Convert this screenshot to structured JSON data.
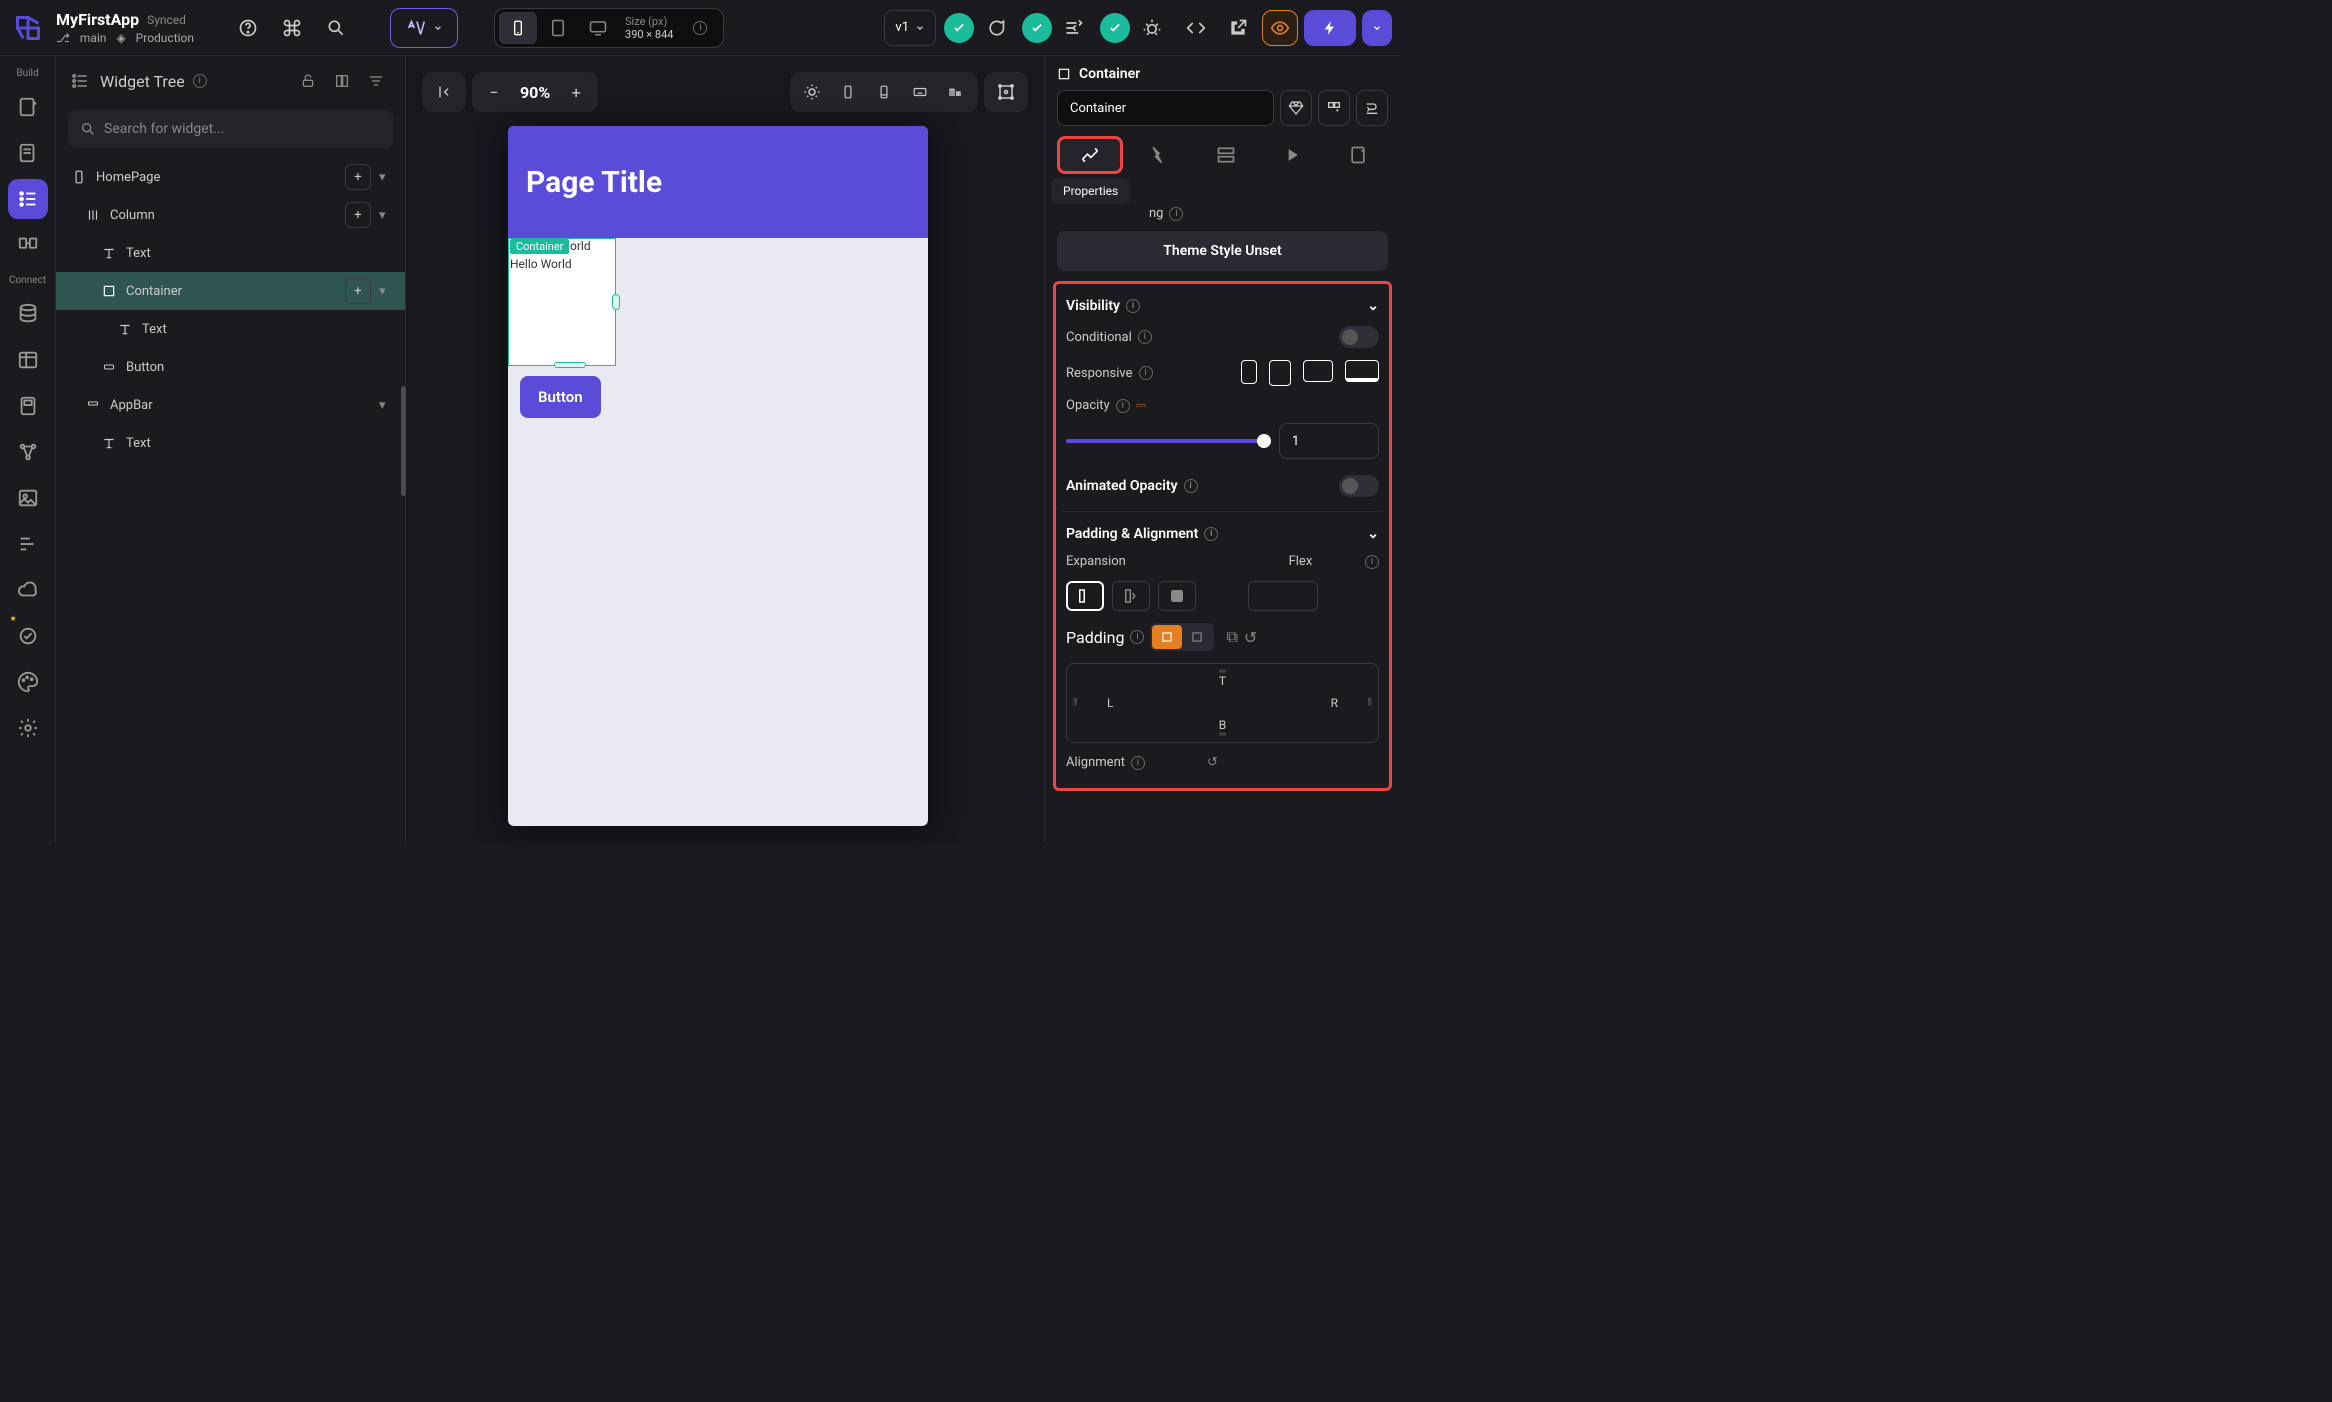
{
  "app": {
    "name": "MyFirstApp",
    "sync": "Synced",
    "branch": "main",
    "env": "Production"
  },
  "device": {
    "sizeLabel": "Size (px)",
    "sizeValue": "390 × 844"
  },
  "version": "v1",
  "zoom": "90%",
  "leftRail": {
    "build": "Build",
    "connect": "Connect"
  },
  "tree": {
    "title": "Widget Tree",
    "searchPlaceholder": "Search for widget...",
    "items": {
      "homepage": "HomePage",
      "column": "Column",
      "text1": "Text",
      "container": "Container",
      "text2": "Text",
      "button": "Button",
      "appbar": "AppBar",
      "text3": "Text"
    }
  },
  "canvas": {
    "pageTitle": "Page Title",
    "selectedLabel": "Container",
    "hello1": "orld",
    "hello2": "Hello World",
    "buttonLabel": "Button"
  },
  "props": {
    "crumb": "Container",
    "nameValue": "Container",
    "tooltip": "Properties",
    "stylingLabel": "ng",
    "themeStyle": "Theme Style Unset",
    "visibility": "Visibility",
    "conditional": "Conditional",
    "responsive": "Responsive",
    "opacity": "Opacity",
    "opacityValue": "1",
    "animatedOpacity": "Animated Opacity",
    "paddingAlign": "Padding & Alignment",
    "expansion": "Expansion",
    "flex": "Flex",
    "padding": "Padding",
    "T": "T",
    "B": "B",
    "L": "L",
    "R": "R",
    "alignment": "Alignment"
  }
}
